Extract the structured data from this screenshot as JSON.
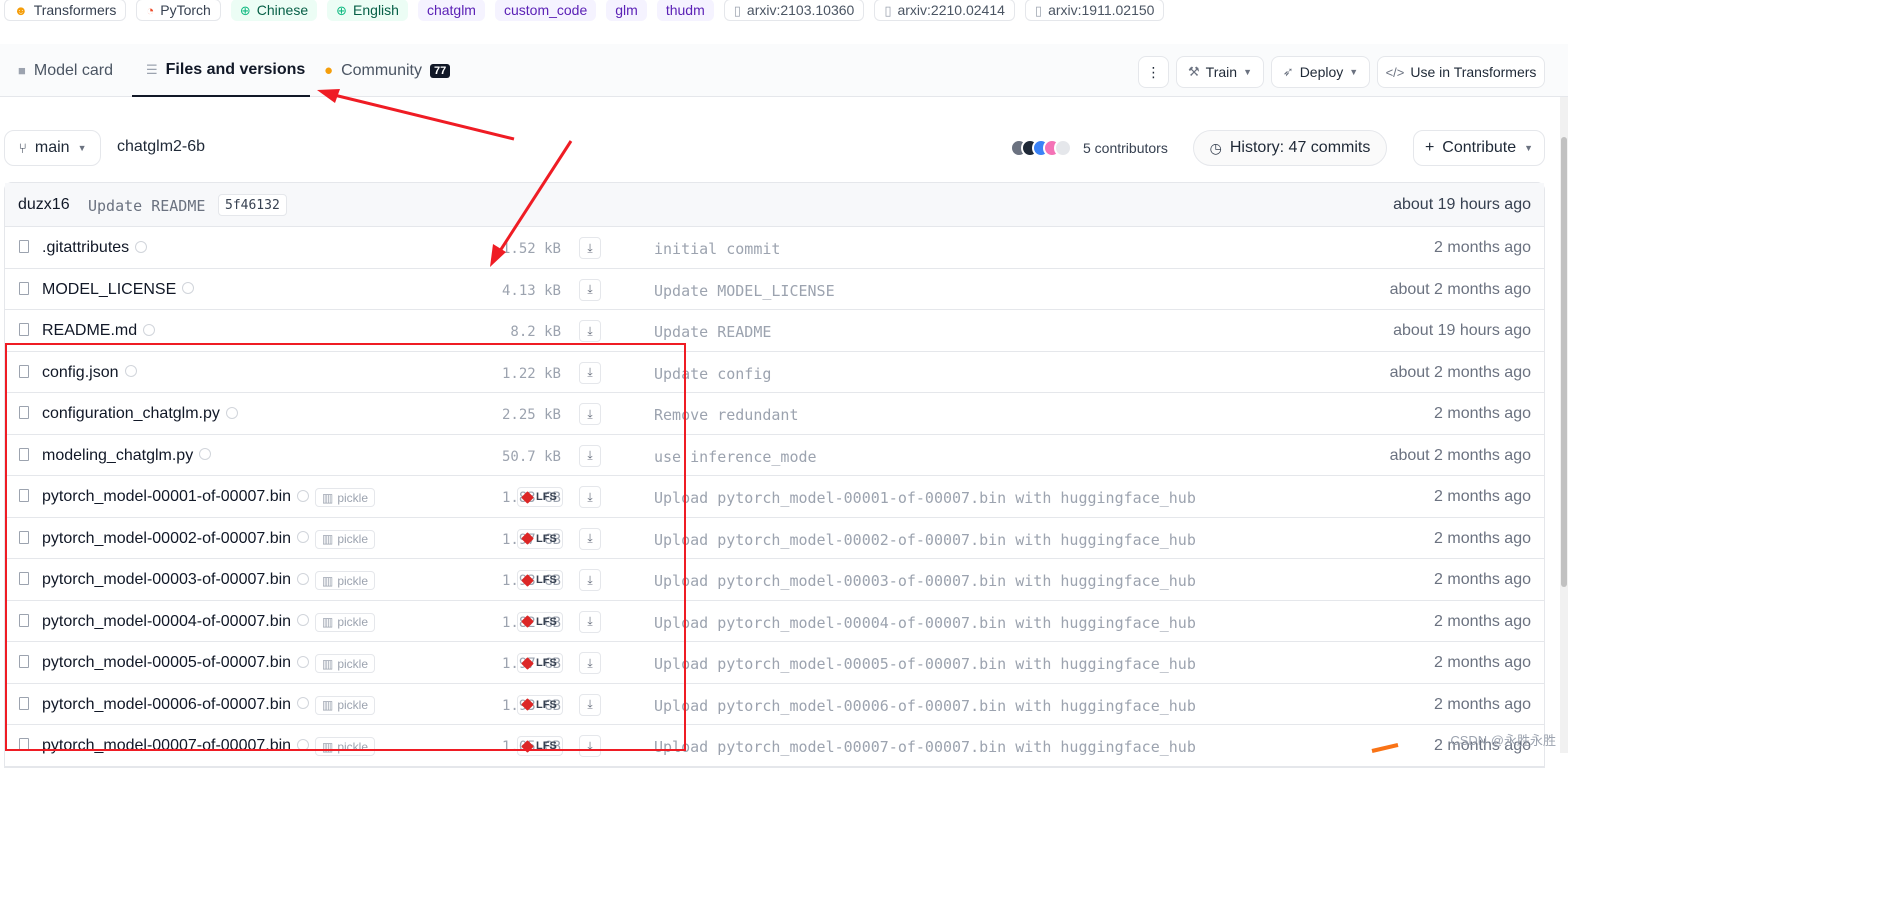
{
  "tags": [
    {
      "label": "Transformers",
      "style": "plain",
      "icon": "hf-icon"
    },
    {
      "label": "PyTorch",
      "style": "plain",
      "icon": "pytorch-icon"
    },
    {
      "label": "Chinese",
      "style": "green",
      "icon": "globe-icon"
    },
    {
      "label": "English",
      "style": "green",
      "icon": "globe-icon"
    },
    {
      "label": "chatglm",
      "style": "purple"
    },
    {
      "label": "custom_code",
      "style": "purple"
    },
    {
      "label": "glm",
      "style": "purple"
    },
    {
      "label": "thudm",
      "style": "purple"
    },
    {
      "label": "arxiv:2103.10360",
      "style": "arxiv",
      "icon": "doc-icon"
    },
    {
      "label": "arxiv:2210.02414",
      "style": "arxiv",
      "icon": "doc-icon"
    },
    {
      "label": "arxiv:1911.02150",
      "style": "arxiv",
      "icon": "doc-icon"
    }
  ],
  "tabs": {
    "model_card": "Model card",
    "files": "Files and versions",
    "community": "Community",
    "community_count": "77"
  },
  "header_buttons": {
    "more": "⋮",
    "train": "Train",
    "deploy": "Deploy",
    "use_in": "Use in Transformers"
  },
  "repo": {
    "branch": "main",
    "path": "chatglm2-6b",
    "contributors": "5 contributors",
    "history": "History: 47 commits",
    "contribute": "Contribute"
  },
  "last_commit": {
    "author": "duzx16",
    "message": "Update README",
    "hash": "5f46132",
    "time": "about 19 hours ago"
  },
  "files": [
    {
      "name": ".gitattributes",
      "size": "1.52 kB",
      "lfs": false,
      "pickle": false,
      "message": "initial commit",
      "time": "2 months ago"
    },
    {
      "name": "MODEL_LICENSE",
      "size": "4.13 kB",
      "lfs": false,
      "pickle": false,
      "message": "Update MODEL_LICENSE",
      "time": "about 2 months ago"
    },
    {
      "name": "README.md",
      "size": "8.2 kB",
      "lfs": false,
      "pickle": false,
      "message": "Update README",
      "time": "about 19 hours ago"
    },
    {
      "name": "config.json",
      "size": "1.22 kB",
      "lfs": false,
      "pickle": false,
      "message": "Update config",
      "time": "about 2 months ago"
    },
    {
      "name": "configuration_chatglm.py",
      "size": "2.25 kB",
      "lfs": false,
      "pickle": false,
      "message": "Remove redundant",
      "time": "2 months ago"
    },
    {
      "name": "modeling_chatglm.py",
      "size": "50.7 kB",
      "lfs": false,
      "pickle": false,
      "message": "use inference_mode",
      "time": "about 2 months ago"
    },
    {
      "name": "pytorch_model-00001-of-00007.bin",
      "size": "1.83 GB",
      "lfs": true,
      "pickle": true,
      "message": "Upload pytorch_model-00001-of-00007.bin with huggingface_hub",
      "time": "2 months ago"
    },
    {
      "name": "pytorch_model-00002-of-00007.bin",
      "size": "1.97 GB",
      "lfs": true,
      "pickle": true,
      "message": "Upload pytorch_model-00002-of-00007.bin with huggingface_hub",
      "time": "2 months ago"
    },
    {
      "name": "pytorch_model-00003-of-00007.bin",
      "size": "1.93 GB",
      "lfs": true,
      "pickle": true,
      "message": "Upload pytorch_model-00003-of-00007.bin with huggingface_hub",
      "time": "2 months ago"
    },
    {
      "name": "pytorch_model-00004-of-00007.bin",
      "size": "1.82 GB",
      "lfs": true,
      "pickle": true,
      "message": "Upload pytorch_model-00004-of-00007.bin with huggingface_hub",
      "time": "2 months ago"
    },
    {
      "name": "pytorch_model-00005-of-00007.bin",
      "size": "1.97 GB",
      "lfs": true,
      "pickle": true,
      "message": "Upload pytorch_model-00005-of-00007.bin with huggingface_hub",
      "time": "2 months ago"
    },
    {
      "name": "pytorch_model-00006-of-00007.bin",
      "size": "1.93 GB",
      "lfs": true,
      "pickle": true,
      "message": "Upload pytorch_model-00006-of-00007.bin with huggingface_hub",
      "time": "2 months ago"
    },
    {
      "name": "pytorch_model-00007-of-00007.bin",
      "size": "1.05 GB",
      "lfs": true,
      "pickle": true,
      "message": "Upload pytorch_model-00007-of-00007.bin with huggingface_hub",
      "time": "2 months ago"
    }
  ],
  "labels": {
    "pickle": "pickle",
    "lfs": "LFS"
  },
  "watermark": "CSDN @永胜永胜",
  "colors": {
    "annotation_red": "#ef1c24",
    "lfs_red": "#dc2626"
  }
}
